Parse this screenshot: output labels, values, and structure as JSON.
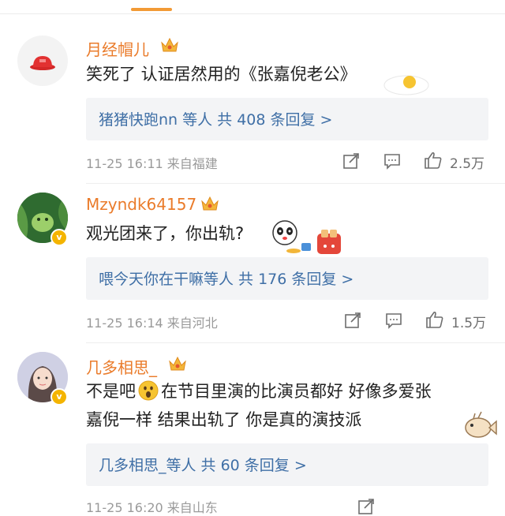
{
  "comments": [
    {
      "username": "月经帽儿",
      "text": "笑死了 认证居然用的《张嘉倪老公》",
      "replies": "猪猪快跑nn 等人 共 408 条回复 >",
      "time": "11-25 16:11",
      "location": "来自福建",
      "likes": "2.5万"
    },
    {
      "username": "Mzyndk64157",
      "text": "观光团来了，你出轨?",
      "replies": "喂今天你在干嘛等人 共 176 条回复 >",
      "time": "11-25 16:14",
      "location": "来自河北",
      "likes": "1.5万"
    },
    {
      "username": "几多相思_",
      "text_line1": "不是吧",
      "text_line1b": "在节目里演的比演员都好 好像多爱张",
      "text_line2": "嘉倪一样 结果出轨了 你是真的演技派",
      "replies": "几多相思_等人 共 60 条回复 >",
      "time": "11-25 16:20",
      "location": "来自山东"
    }
  ],
  "icons": {
    "avatar_badge": "v",
    "crown": "crown-icon",
    "share": "share-icon",
    "comment": "comment-icon",
    "like": "thumbs-up-icon"
  },
  "colors": {
    "accent": "#f29a35",
    "username": "#ea7b2a",
    "link": "#3f6fa6",
    "meta": "#9a9a9a"
  }
}
